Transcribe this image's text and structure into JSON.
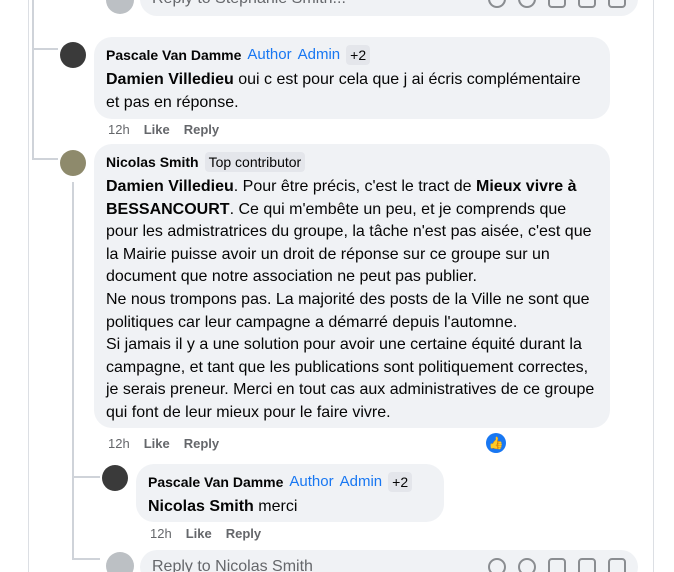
{
  "top_reply": {
    "placeholder": "Reply to Stephanie Smith..."
  },
  "comments": [
    {
      "author": "Pascale Van Damme",
      "badges": [
        "Author",
        "Admin"
      ],
      "extra": "+2",
      "mention": "Damien Villedieu",
      "text": " oui c est pour cela que j ai écris complémentaire et pas en réponse.",
      "time": "12h",
      "like": "Like",
      "reply": "Reply"
    },
    {
      "author": "Nicolas Smith",
      "badge": "Top contributor",
      "mention": "Damien Villedieu",
      "text1": ". Pour être précis, c'est le tract de ",
      "bold2": "Mieux vivre à BESSANCOURT",
      "text2": ". Ce qui m'embête un peu, et je comprends que pour les admistratrices du groupe, la tâche n'est pas aisée, c'est que la Mairie puisse avoir un droit de réponse sur ce groupe sur un document que notre association ne peut pas publier.",
      "para2": "Ne nous trompons pas. La majorité des posts de la Ville ne sont que politiques car leur campagne a démarré depuis l'automne.",
      "para3": "Si jamais il y a une solution pour avoir une certaine équité durant la campagne, et tant que les publications sont politiquement correctes, je serais preneur. Merci en tout cas aux administratives de ce groupe qui font de leur mieux pour le faire vivre.",
      "time": "12h",
      "like": "Like",
      "reply": "Reply"
    },
    {
      "author": "Pascale Van Damme",
      "badges": [
        "Author",
        "Admin"
      ],
      "extra": "+2",
      "mention": "Nicolas Smith",
      "text": " merci",
      "time": "12h",
      "like": "Like",
      "reply": "Reply"
    }
  ],
  "bottom_reply": {
    "placeholder": "Reply to Nicolas Smith"
  },
  "colors": {
    "link": "#1877f2",
    "bubble": "#f0f2f5",
    "muted": "#65676b"
  }
}
